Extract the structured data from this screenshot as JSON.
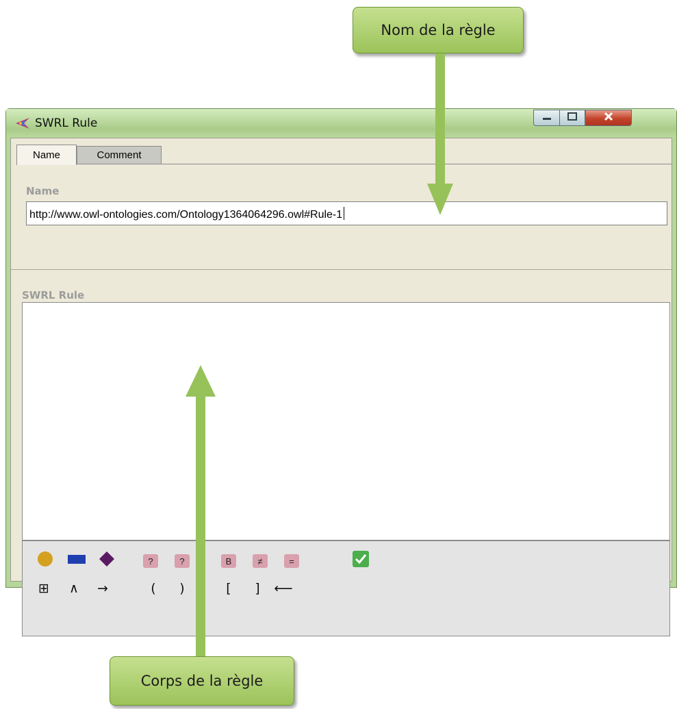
{
  "callouts": {
    "rule_name": "Nom de la règle",
    "rule_body": "Corps de la règle"
  },
  "window": {
    "title": "SWRL Rule",
    "icon": "protege-logo-icon",
    "controls": [
      "minimize-icon",
      "maximize-icon",
      "close-icon"
    ]
  },
  "tabs": [
    {
      "label": "Name",
      "selected": true
    },
    {
      "label": "Comment",
      "selected": false
    }
  ],
  "name_section": {
    "label": "Name",
    "value": "http://www.owl-ontologies.com/Ontology1364064296.owl#Rule-1"
  },
  "rule_section": {
    "label": "SWRL Rule",
    "value": ""
  },
  "palette": {
    "row1": [
      {
        "icon": "class-circle-icon"
      },
      {
        "icon": "property-rectangle-icon"
      },
      {
        "icon": "individual-diamond-icon"
      },
      {
        "icon": "variable-wand-icon",
        "label": "?"
      },
      {
        "icon": "variable-add-icon",
        "label": "?"
      },
      {
        "icon": "builtin-icon",
        "label": "B"
      },
      {
        "icon": "different-from-icon",
        "label": "≠"
      },
      {
        "icon": "same-as-icon",
        "label": "="
      },
      {
        "icon": "ok-check-icon"
      }
    ],
    "row2": [
      {
        "icon": "data-range-icon",
        "label": "⊞"
      },
      {
        "icon": "and-icon",
        "label": "∧"
      },
      {
        "icon": "implies-icon",
        "label": "→"
      },
      {
        "icon": "open-paren-icon",
        "label": "("
      },
      {
        "icon": "close-paren-icon",
        "label": ")"
      },
      {
        "icon": "open-bracket-icon",
        "label": "["
      },
      {
        "icon": "close-bracket-icon",
        "label": "]"
      },
      {
        "icon": "backspace-icon",
        "label": "⟵"
      }
    ]
  },
  "colors": {
    "callout": "#9cc35a",
    "arrow": "#97c25a",
    "class": "#d4a020",
    "property": "#1f3fb0",
    "individual": "#5a1a62",
    "pink_button": "#d9a0ad",
    "ok": "#4cae4c"
  }
}
